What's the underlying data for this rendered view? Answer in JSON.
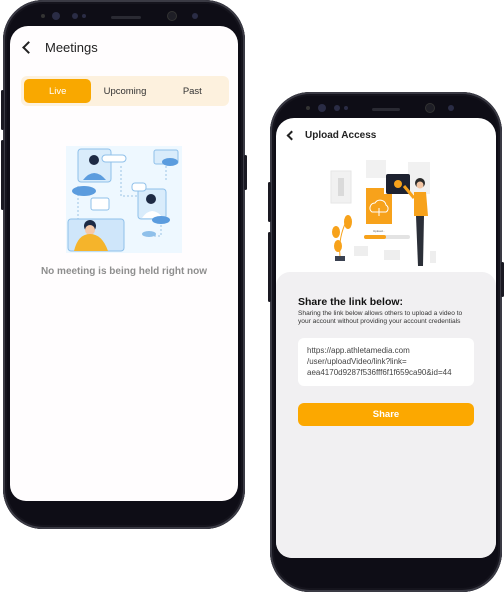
{
  "meetings_screen": {
    "title": "Meetings",
    "back_icon": "chevron-left-icon",
    "tabs": [
      {
        "label": "Live",
        "active": true
      },
      {
        "label": "Upcoming",
        "active": false
      },
      {
        "label": "Past",
        "active": false
      }
    ],
    "illustration": "video-conference-illustration",
    "empty_message": "No meeting is being held right now"
  },
  "upload_screen": {
    "title": "Upload Access",
    "back_icon": "chevron-left-icon",
    "illustration": "file-upload-illustration",
    "illustration_caption": "Upload...",
    "share_title": "Share the link below:",
    "share_description": "Sharing the link below allows others to upload a video to your account without providing your account credentials",
    "link_lines": [
      "https://app.athletamedia.com",
      "/user/uploadVideo/link?link=",
      "aea4170d9287f536fff6f1f659ca90&id=44"
    ],
    "share_button_label": "Share"
  },
  "colors": {
    "accent": "#f9a800",
    "tab_bar_bg": "#fdf1de",
    "panel_bg": "#f1f0f2",
    "muted_text": "#8e8e8e",
    "phone_frame": "#0e0d16"
  }
}
